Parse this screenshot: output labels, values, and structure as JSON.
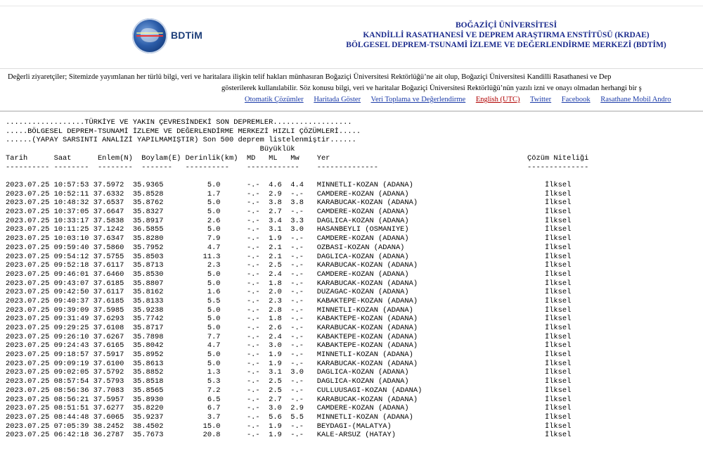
{
  "logo": {
    "text": "BDTiM"
  },
  "header": {
    "title1": "BOĞAZİÇİ ÜNİVERSİTESİ",
    "title2": "KANDİLLİ RASATHANESİ VE DEPREM ARAŞTIRMA ENSTİTÜSÜ (KRDAE)",
    "title3": "BÖLGESEL DEPREM-TSUNAMİ İZLEME VE DEĞERLENDİRME MERKEZİ (BDTİM)"
  },
  "notice": {
    "line1": "Değerli ziyaretçiler; Sitemizde yayımlanan her türlü bilgi, veri ve haritalara ilişkin telif hakları münhasıran Boğaziçi Üniversitesi Rektörlüğü’ne ait olup, Boğaziçi Üniversitesi Kandilli Rasathanesi ve Dep",
    "line2": "gösterilerek kullanılabilir. Söz konusu bilgi, veri ve haritalar Boğaziçi Üniversitesi Rektörlüğü’nün yazılı izni ve onayı olmadan herhangi bir ş"
  },
  "links": {
    "auto": "Otomatik Çözümler",
    "map": "Haritada Göster",
    "data": "Veri Toplama ve Değerlendirme",
    "english": "English (UTC)",
    "twitter": "Twitter",
    "facebook": "Facebook",
    "mobile": "Rasathane Mobil Andro"
  },
  "list_header": {
    "line1": "..................TÜRKİYE VE YAKIN ÇEVRESİNDEKİ SON DEPREMLER..................",
    "line2": ".....BÖLGESEL DEPREM-TSUNAMİ İZLEME VE DEĞERLENDİRME MERKEZİ HIZLI ÇÖZÜMLERİ.....",
    "line3": "......(YAPAY SARSINTI ANALİZİ YAPILMAMIŞTIR) Son 500 deprem listelenmiştir......",
    "line4": "                                                          Büyüklük",
    "columns": "Tarih      Saat      Enlem(N)  Boylam(E) Derinlik(km)  MD   ML   Mw    Yer                                             Çözüm Niteliği",
    "dashes": "---------- --------  --------  -------   ----------    ------------    --------------                                  --------------"
  },
  "earthquakes": [
    {
      "date": "2023.07.25",
      "time": "10:57:53",
      "lat": "37.5972",
      "lon": "35.9365",
      "depth": "5.0",
      "md": "-.-",
      "ml": "4.6",
      "mw": "4.4",
      "place": "MINNETLI-KOZAN (ADANA)",
      "quality": "İlksel"
    },
    {
      "date": "2023.07.25",
      "time": "10:52:11",
      "lat": "37.6332",
      "lon": "35.8528",
      "depth": "1.7",
      "md": "-.-",
      "ml": "2.9",
      "mw": "-.-",
      "place": "CAMDERE-KOZAN (ADANA)",
      "quality": "İlksel"
    },
    {
      "date": "2023.07.25",
      "time": "10:48:32",
      "lat": "37.6537",
      "lon": "35.8762",
      "depth": "5.0",
      "md": "-.-",
      "ml": "3.8",
      "mw": "3.8",
      "place": "KARABUCAK-KOZAN (ADANA)",
      "quality": "İlksel"
    },
    {
      "date": "2023.07.25",
      "time": "10:37:05",
      "lat": "37.6647",
      "lon": "35.8327",
      "depth": "5.0",
      "md": "-.-",
      "ml": "2.7",
      "mw": "-.-",
      "place": "CAMDERE-KOZAN (ADANA)",
      "quality": "İlksel"
    },
    {
      "date": "2023.07.25",
      "time": "10:33:17",
      "lat": "37.5838",
      "lon": "35.8917",
      "depth": "2.6",
      "md": "-.-",
      "ml": "3.4",
      "mw": "3.3",
      "place": "DAGLICA-KOZAN (ADANA)",
      "quality": "İlksel"
    },
    {
      "date": "2023.07.25",
      "time": "10:11:25",
      "lat": "37.1242",
      "lon": "36.5855",
      "depth": "5.0",
      "md": "-.-",
      "ml": "3.1",
      "mw": "3.0",
      "place": "HASANBEYLI (OSMANIYE)",
      "quality": "İlksel"
    },
    {
      "date": "2023.07.25",
      "time": "10:03:10",
      "lat": "37.6347",
      "lon": "35.8280",
      "depth": "7.9",
      "md": "-.-",
      "ml": "1.9",
      "mw": "-.-",
      "place": "CAMDERE-KOZAN (ADANA)",
      "quality": "İlksel"
    },
    {
      "date": "2023.07.25",
      "time": "09:59:40",
      "lat": "37.5860",
      "lon": "35.7952",
      "depth": "4.7",
      "md": "-.-",
      "ml": "2.1",
      "mw": "-.-",
      "place": "OZBASI-KOZAN (ADANA)",
      "quality": "İlksel"
    },
    {
      "date": "2023.07.25",
      "time": "09:54:12",
      "lat": "37.5755",
      "lon": "35.8503",
      "depth": "11.3",
      "md": "-.-",
      "ml": "2.1",
      "mw": "-.-",
      "place": "DAGLICA-KOZAN (ADANA)",
      "quality": "İlksel"
    },
    {
      "date": "2023.07.25",
      "time": "09:52:18",
      "lat": "37.6117",
      "lon": "35.8713",
      "depth": "2.3",
      "md": "-.-",
      "ml": "2.5",
      "mw": "-.-",
      "place": "KARABUCAK-KOZAN (ADANA)",
      "quality": "İlksel"
    },
    {
      "date": "2023.07.25",
      "time": "09:46:01",
      "lat": "37.6460",
      "lon": "35.8530",
      "depth": "5.0",
      "md": "-.-",
      "ml": "2.4",
      "mw": "-.-",
      "place": "CAMDERE-KOZAN (ADANA)",
      "quality": "İlksel"
    },
    {
      "date": "2023.07.25",
      "time": "09:43:07",
      "lat": "37.6185",
      "lon": "35.8807",
      "depth": "5.0",
      "md": "-.-",
      "ml": "1.8",
      "mw": "-.-",
      "place": "KARABUCAK-KOZAN (ADANA)",
      "quality": "İlksel"
    },
    {
      "date": "2023.07.25",
      "time": "09:42:50",
      "lat": "37.6117",
      "lon": "35.8162",
      "depth": "1.6",
      "md": "-.-",
      "ml": "2.0",
      "mw": "-.-",
      "place": "DUZAGAC-KOZAN (ADANA)",
      "quality": "İlksel"
    },
    {
      "date": "2023.07.25",
      "time": "09:40:37",
      "lat": "37.6185",
      "lon": "35.8133",
      "depth": "5.5",
      "md": "-.-",
      "ml": "2.3",
      "mw": "-.-",
      "place": "KABAKTEPE-KOZAN (ADANA)",
      "quality": "İlksel"
    },
    {
      "date": "2023.07.25",
      "time": "09:39:09",
      "lat": "37.5985",
      "lon": "35.9238",
      "depth": "5.0",
      "md": "-.-",
      "ml": "2.8",
      "mw": "-.-",
      "place": "MINNETLI-KOZAN (ADANA)",
      "quality": "İlksel"
    },
    {
      "date": "2023.07.25",
      "time": "09:31:49",
      "lat": "37.6293",
      "lon": "35.7742",
      "depth": "5.0",
      "md": "-.-",
      "ml": "1.8",
      "mw": "-.-",
      "place": "KABAKTEPE-KOZAN (ADANA)",
      "quality": "İlksel"
    },
    {
      "date": "2023.07.25",
      "time": "09:29:25",
      "lat": "37.6108",
      "lon": "35.8717",
      "depth": "5.0",
      "md": "-.-",
      "ml": "2.6",
      "mw": "-.-",
      "place": "KARABUCAK-KOZAN (ADANA)",
      "quality": "İlksel"
    },
    {
      "date": "2023.07.25",
      "time": "09:26:10",
      "lat": "37.6267",
      "lon": "35.7898",
      "depth": "7.7",
      "md": "-.-",
      "ml": "2.4",
      "mw": "-.-",
      "place": "KABAKTEPE-KOZAN (ADANA)",
      "quality": "İlksel"
    },
    {
      "date": "2023.07.25",
      "time": "09:24:43",
      "lat": "37.6165",
      "lon": "35.8042",
      "depth": "4.7",
      "md": "-.-",
      "ml": "3.0",
      "mw": "-.-",
      "place": "KABAKTEPE-KOZAN (ADANA)",
      "quality": "İlksel"
    },
    {
      "date": "2023.07.25",
      "time": "09:18:57",
      "lat": "37.5917",
      "lon": "35.8952",
      "depth": "5.0",
      "md": "-.-",
      "ml": "1.9",
      "mw": "-.-",
      "place": "MINNETLI-KOZAN (ADANA)",
      "quality": "İlksel"
    },
    {
      "date": "2023.07.25",
      "time": "09:09:19",
      "lat": "37.6100",
      "lon": "35.8613",
      "depth": "5.0",
      "md": "-.-",
      "ml": "1.9",
      "mw": "-.-",
      "place": "KARABUCAK-KOZAN (ADANA)",
      "quality": "İlksel"
    },
    {
      "date": "2023.07.25",
      "time": "09:02:05",
      "lat": "37.5792",
      "lon": "35.8852",
      "depth": "1.3",
      "md": "-.-",
      "ml": "3.1",
      "mw": "3.0",
      "place": "DAGLICA-KOZAN (ADANA)",
      "quality": "İlksel"
    },
    {
      "date": "2023.07.25",
      "time": "08:57:54",
      "lat": "37.5793",
      "lon": "35.8518",
      "depth": "5.3",
      "md": "-.-",
      "ml": "2.5",
      "mw": "-.-",
      "place": "DAGLICA-KOZAN (ADANA)",
      "quality": "İlksel"
    },
    {
      "date": "2023.07.25",
      "time": "08:56:36",
      "lat": "37.7083",
      "lon": "35.8565",
      "depth": "7.2",
      "md": "-.-",
      "ml": "2.5",
      "mw": "-.-",
      "place": "CULLUUSAGI-KOZAN (ADANA)",
      "quality": "İlksel"
    },
    {
      "date": "2023.07.25",
      "time": "08:56:21",
      "lat": "37.5957",
      "lon": "35.8930",
      "depth": "6.5",
      "md": "-.-",
      "ml": "2.7",
      "mw": "-.-",
      "place": "KARABUCAK-KOZAN (ADANA)",
      "quality": "İlksel"
    },
    {
      "date": "2023.07.25",
      "time": "08:51:51",
      "lat": "37.6277",
      "lon": "35.8220",
      "depth": "6.7",
      "md": "-.-",
      "ml": "3.0",
      "mw": "2.9",
      "place": "CAMDERE-KOZAN (ADANA)",
      "quality": "İlksel"
    },
    {
      "date": "2023.07.25",
      "time": "08:44:48",
      "lat": "37.6065",
      "lon": "35.9237",
      "depth": "3.7",
      "md": "-.-",
      "ml": "5.6",
      "mw": "5.5",
      "place": "MINNETLI-KOZAN (ADANA)",
      "quality": "İlksel"
    },
    {
      "date": "2023.07.25",
      "time": "07:05:39",
      "lat": "38.2452",
      "lon": "38.4502",
      "depth": "15.0",
      "md": "-.-",
      "ml": "1.9",
      "mw": "-.-",
      "place": "BEYDAGI-(MALATYA)",
      "quality": "İlksel"
    },
    {
      "date": "2023.07.25",
      "time": "06:42:18",
      "lat": "36.2787",
      "lon": "35.7673",
      "depth": "20.8",
      "md": "-.-",
      "ml": "1.9",
      "mw": "-.-",
      "place": "KALE-ARSUZ (HATAY)",
      "quality": "İlksel"
    }
  ]
}
